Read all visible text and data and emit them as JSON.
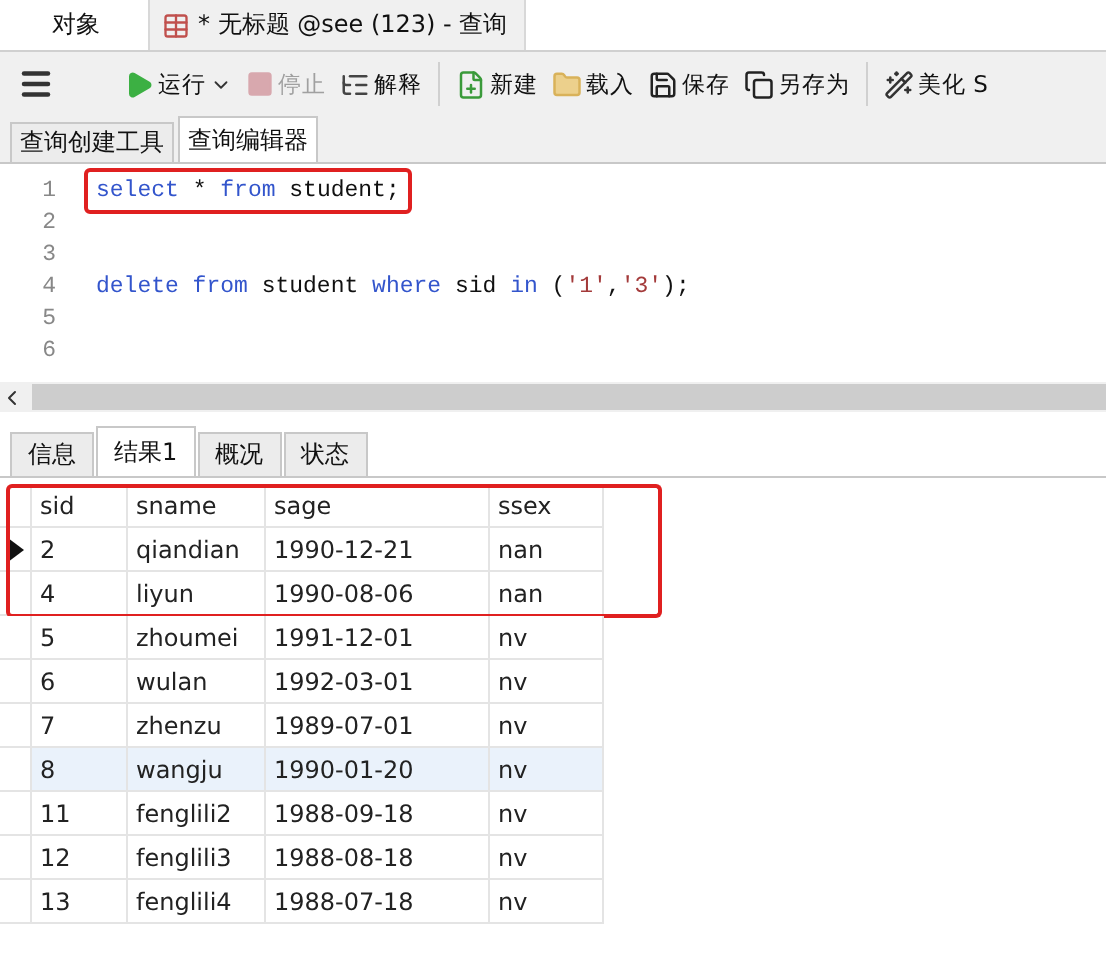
{
  "doc_tabs": [
    {
      "label": "对象",
      "selected": false,
      "kind": "objects"
    },
    {
      "label": "* 无标题 @see (123) - 查询",
      "selected": true,
      "kind": "query"
    }
  ],
  "toolbar": [
    {
      "kind": "menu"
    },
    {
      "kind": "run",
      "label": "运行",
      "disabled": false
    },
    {
      "kind": "stop",
      "label": "停止",
      "disabled": true
    },
    {
      "kind": "explain",
      "label": "解释",
      "disabled": false
    },
    {
      "kind": "separator"
    },
    {
      "kind": "new",
      "label": "新建",
      "disabled": false
    },
    {
      "kind": "load",
      "label": "载入",
      "disabled": false
    },
    {
      "kind": "save",
      "label": "保存",
      "disabled": false
    },
    {
      "kind": "saveas",
      "label": "另存为",
      "disabled": false
    },
    {
      "kind": "separator"
    },
    {
      "kind": "beautify",
      "label": "美化 S",
      "disabled": false
    }
  ],
  "editor_tabs": [
    {
      "label": "查询创建工具",
      "selected": false
    },
    {
      "label": "查询编辑器",
      "selected": true
    }
  ],
  "editor": {
    "lines": [
      {
        "number": "1",
        "highlighted": true,
        "tokens": [
          {
            "kind": "keyword",
            "text": "select"
          },
          {
            "kind": "plain",
            "text": " * "
          },
          {
            "kind": "keyword",
            "text": "from"
          },
          {
            "kind": "plain",
            "text": " student;"
          }
        ]
      },
      {
        "number": "2"
      },
      {
        "number": "3"
      },
      {
        "number": "4",
        "highlighted": false,
        "tokens": [
          {
            "kind": "keyword",
            "text": "delete from"
          },
          {
            "kind": "plain",
            "text": " student "
          },
          {
            "kind": "keyword",
            "text": "where"
          },
          {
            "kind": "plain",
            "text": " sid "
          },
          {
            "kind": "keyword",
            "text": "in"
          },
          {
            "kind": "plain",
            "text": " ("
          },
          {
            "kind": "string",
            "text": "'1'"
          },
          {
            "kind": "plain",
            "text": ","
          },
          {
            "kind": "string",
            "text": "'3'"
          },
          {
            "kind": "plain",
            "text": ");"
          }
        ]
      },
      {
        "number": "5"
      },
      {
        "number": "6"
      }
    ]
  },
  "result_tabs": [
    {
      "label": "信息",
      "selected": false
    },
    {
      "label": "结果1",
      "selected": true
    },
    {
      "label": "概况",
      "selected": false
    },
    {
      "label": "状态",
      "selected": false
    }
  ],
  "table": {
    "columns": [
      "sid",
      "sname",
      "sage",
      "ssex"
    ],
    "rows": [
      {
        "cells": [
          "2",
          "qiandian",
          "1990-12-21",
          "nan"
        ],
        "selected": true,
        "highlighted": true,
        "hovered": false
      },
      {
        "cells": [
          "4",
          "liyun",
          "1990-08-06",
          "nan"
        ],
        "selected": false,
        "highlighted": true,
        "hovered": false
      },
      {
        "cells": [
          "5",
          "zhoumei",
          "1991-12-01",
          "nv"
        ],
        "selected": false,
        "highlighted": false,
        "hovered": false
      },
      {
        "cells": [
          "6",
          "wulan",
          "1992-03-01",
          "nv"
        ],
        "selected": false,
        "highlighted": false,
        "hovered": false
      },
      {
        "cells": [
          "7",
          "zhenzu",
          "1989-07-01",
          "nv"
        ],
        "selected": false,
        "highlighted": false,
        "hovered": false
      },
      {
        "cells": [
          "8",
          "wangju",
          "1990-01-20",
          "nv"
        ],
        "selected": false,
        "highlighted": false,
        "hovered": true
      },
      {
        "cells": [
          "11",
          "fenglili2",
          "1988-09-18",
          "nv"
        ],
        "selected": false,
        "highlighted": false,
        "hovered": false
      },
      {
        "cells": [
          "12",
          "fenglili3",
          "1988-08-18",
          "nv"
        ],
        "selected": false,
        "highlighted": false,
        "hovered": false
      },
      {
        "cells": [
          "13",
          "fenglili4",
          "1988-07-18",
          "nv"
        ],
        "selected": false,
        "highlighted": false,
        "hovered": false
      }
    ]
  }
}
